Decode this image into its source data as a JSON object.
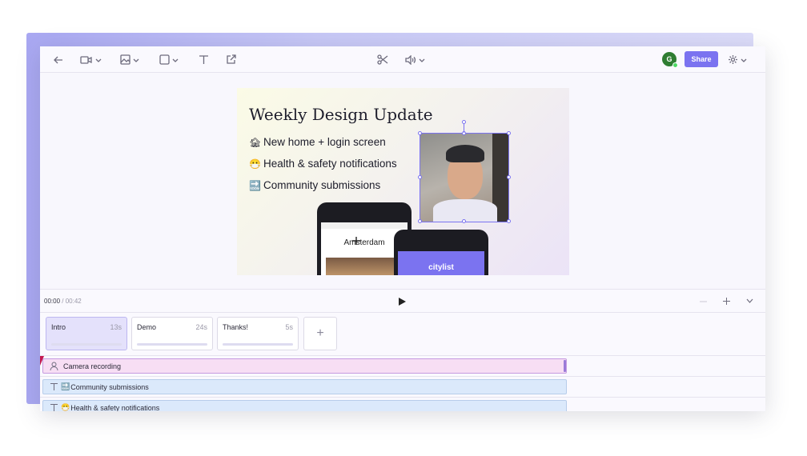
{
  "toolbar": {
    "avatar_initial": "G",
    "share_label": "Share"
  },
  "slide": {
    "title": "Weekly Design Update",
    "bullets": [
      {
        "emoji": "🏚",
        "text": "New home + login screen"
      },
      {
        "emoji": "😷",
        "text": "Health & safety notifications"
      },
      {
        "emoji": "🔜",
        "text": "Community submissions"
      }
    ],
    "phone1_city": "Amsterdam",
    "phone2_app": "citylist"
  },
  "playback": {
    "current": "00:00",
    "separator": " / ",
    "total": "00:42"
  },
  "scenes": [
    {
      "name": "Intro",
      "duration": "13s"
    },
    {
      "name": "Demo",
      "duration": "24s"
    },
    {
      "name": "Thanks!",
      "duration": "5s"
    }
  ],
  "add_scene_label": "+",
  "tracks": [
    {
      "label": "Camera recording",
      "emoji": ""
    },
    {
      "label": "Community submissions",
      "emoji": "🔜"
    },
    {
      "label": "Health & safety notifications",
      "emoji": "😷"
    }
  ],
  "colors": {
    "accent": "#7b73f0",
    "avatar": "#2f7d32",
    "playhead": "#c4184f"
  }
}
